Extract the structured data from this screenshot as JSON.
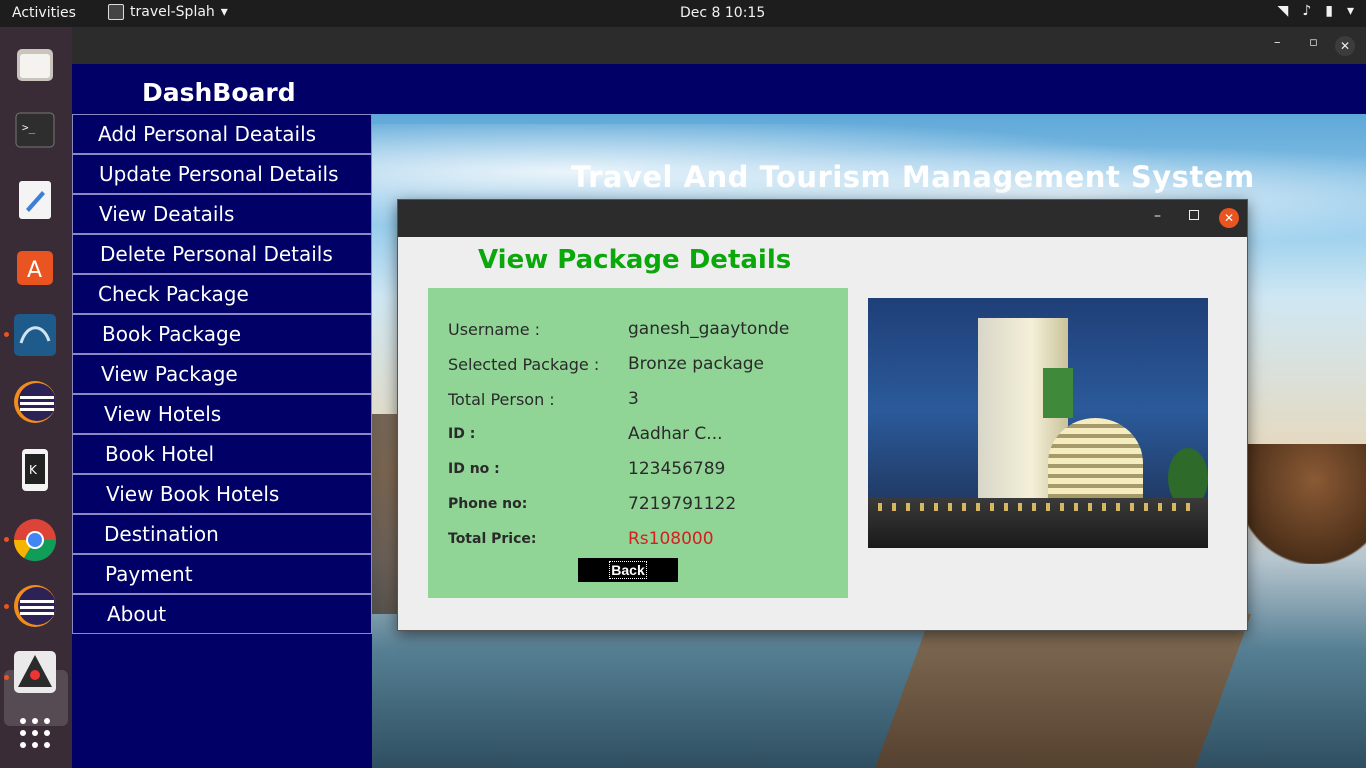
{
  "topbar": {
    "activities": "Activities",
    "app_name": "travel-Splah",
    "clock": "Dec 8  10:15"
  },
  "dock": {
    "items": [
      "files-icon",
      "terminal-icon",
      "text-editor-icon",
      "app-store-icon",
      "mysql-workbench-icon",
      "eclipse-icon",
      "kde-connect-icon",
      "chrome-icon",
      "eclipse-icon",
      "java-app-icon",
      "show-apps-icon"
    ]
  },
  "window": {
    "dashboard_title": "DashBoard",
    "main_heading": "Travel And Tourism Management System"
  },
  "sidebar": {
    "items": [
      {
        "label": "Add Personal Deatails"
      },
      {
        "label": "Update Personal Details"
      },
      {
        "label": "View Deatails"
      },
      {
        "label": "Delete Personal Details"
      },
      {
        "label": "Check Package"
      },
      {
        "label": "Book Package"
      },
      {
        "label": "View Package"
      },
      {
        "label": "View Hotels"
      },
      {
        "label": "Book Hotel"
      },
      {
        "label": "View Book Hotels"
      },
      {
        "label": "Destination"
      },
      {
        "label": "Payment"
      },
      {
        "label": "About"
      }
    ]
  },
  "dialog": {
    "heading": "View Package Details",
    "fields": [
      {
        "label": "Username :",
        "value": "ganesh_gaaytonde"
      },
      {
        "label": "Selected Package :",
        "value": "Bronze package"
      },
      {
        "label": "Total Person :",
        "value": "3"
      },
      {
        "label": "ID :",
        "value": "Aadhar C..."
      },
      {
        "label": "ID no :",
        "value": "123456789"
      },
      {
        "label": "Phone no:",
        "value": "7219791122"
      },
      {
        "label": "Total Price:",
        "value": "Rs108000"
      }
    ],
    "back_label": "Back"
  },
  "colors": {
    "sidebar_bg": "#000066",
    "heading_green": "#0aa80a",
    "panel_green": "#90d595",
    "price_red": "#d42020",
    "ubuntu_orange": "#e95420"
  }
}
